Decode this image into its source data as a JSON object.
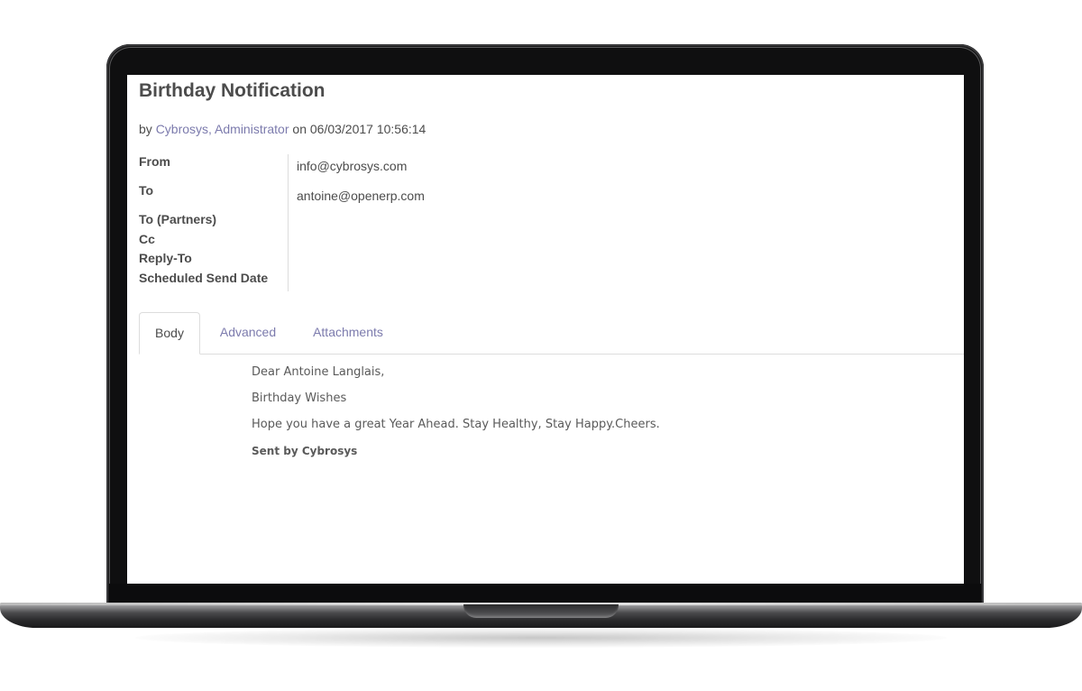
{
  "email": {
    "title": "Birthday Notification",
    "byline": {
      "prefix": "by ",
      "author": "Cybrosys, Administrator",
      "on_text": " on ",
      "datetime": "06/03/2017 10:56:14"
    },
    "fields": [
      {
        "label": "From",
        "value": "info@cybrosys.com"
      },
      {
        "label": "To",
        "value": "antoine@openerp.com"
      },
      {
        "label": "To (Partners)",
        "value": ""
      },
      {
        "label": "Cc",
        "value": ""
      },
      {
        "label": "Reply-To",
        "value": ""
      },
      {
        "label": "Scheduled Send Date",
        "value": ""
      }
    ],
    "tabs": [
      {
        "label": "Body",
        "active": true
      },
      {
        "label": "Advanced",
        "active": false
      },
      {
        "label": "Attachments",
        "active": false
      }
    ],
    "body": {
      "greeting": "Dear Antoine Langlais,",
      "line1": "Birthday Wishes",
      "line2": "Hope you have a great Year Ahead. Stay Healthy, Stay Happy.Cheers.",
      "signature": "Sent by Cybrosys"
    }
  },
  "colors": {
    "link": "#7c7bad",
    "text": "#4c4c4c",
    "bezel": "#0f0f10"
  }
}
